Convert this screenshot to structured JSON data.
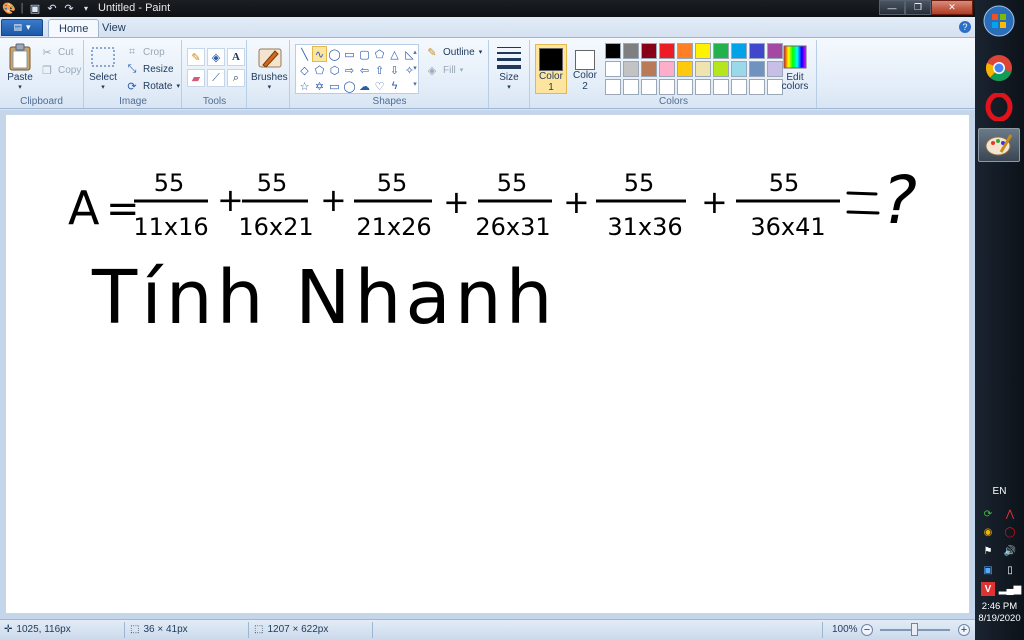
{
  "window": {
    "title": "Untitled - Paint",
    "controls": {
      "minimize": "—",
      "maximize": "❐",
      "close": "✕"
    }
  },
  "tabs": [
    {
      "label": "Home",
      "active": true
    },
    {
      "label": "View",
      "active": false
    }
  ],
  "ribbon": {
    "clipboard": {
      "label": "Clipboard",
      "paste": "Paste",
      "cut": "Cut",
      "copy": "Copy"
    },
    "image": {
      "label": "Image",
      "select": "Select",
      "crop": "Crop",
      "resize": "Resize",
      "rotate": "Rotate"
    },
    "tools": {
      "label": "Tools"
    },
    "brushes": {
      "label": "Brushes"
    },
    "shapes": {
      "label": "Shapes",
      "outline": "Outline",
      "fill": "Fill"
    },
    "size": {
      "label": "Size"
    },
    "colors": {
      "label": "Colors",
      "color1": {
        "label_line1": "Color",
        "label_line2": "1",
        "value": "#000000"
      },
      "color2": {
        "label_line1": "Color",
        "label_line2": "2",
        "value": "#ffffff"
      },
      "edit_colors_line1": "Edit",
      "edit_colors_line2": "colors",
      "palette": [
        "#000000",
        "#7f7f7f",
        "#880015",
        "#ed1c24",
        "#ff7f27",
        "#fff200",
        "#22b14c",
        "#00a2e8",
        "#3f48cc",
        "#a349a4",
        "#ffffff",
        "#c3c3c3",
        "#b97a57",
        "#ffaec9",
        "#ffc90e",
        "#efe4b0",
        "#b5e61d",
        "#99d9ea",
        "#7092be",
        "#c8bfe7",
        "#ffffff",
        "#ffffff",
        "#ffffff",
        "#ffffff",
        "#ffffff",
        "#ffffff",
        "#ffffff",
        "#ffffff",
        "#ffffff",
        "#ffffff"
      ]
    }
  },
  "canvas": {
    "lhs": "A",
    "equals": "=",
    "plus": "+",
    "fractions": [
      {
        "numerator": "55",
        "denominator": "11x16"
      },
      {
        "numerator": "55",
        "denominator": "16x21"
      },
      {
        "numerator": "55",
        "denominator": "21x26"
      },
      {
        "numerator": "55",
        "denominator": "26x31"
      },
      {
        "numerator": "55",
        "denominator": "31x36"
      },
      {
        "numerator": "55",
        "denominator": "36x41"
      }
    ],
    "result": "?",
    "handwriting": "Tính Nhanh"
  },
  "statusbar": {
    "cursor_pos": "1025, 116px",
    "selection_size": "36 × 41px",
    "image_size": "1207 × 622px",
    "zoom": "100%",
    "zoom_level": 0.5
  },
  "taskbar": {
    "language": "EN",
    "time": "2:46 PM",
    "date": "8/19/2020"
  }
}
